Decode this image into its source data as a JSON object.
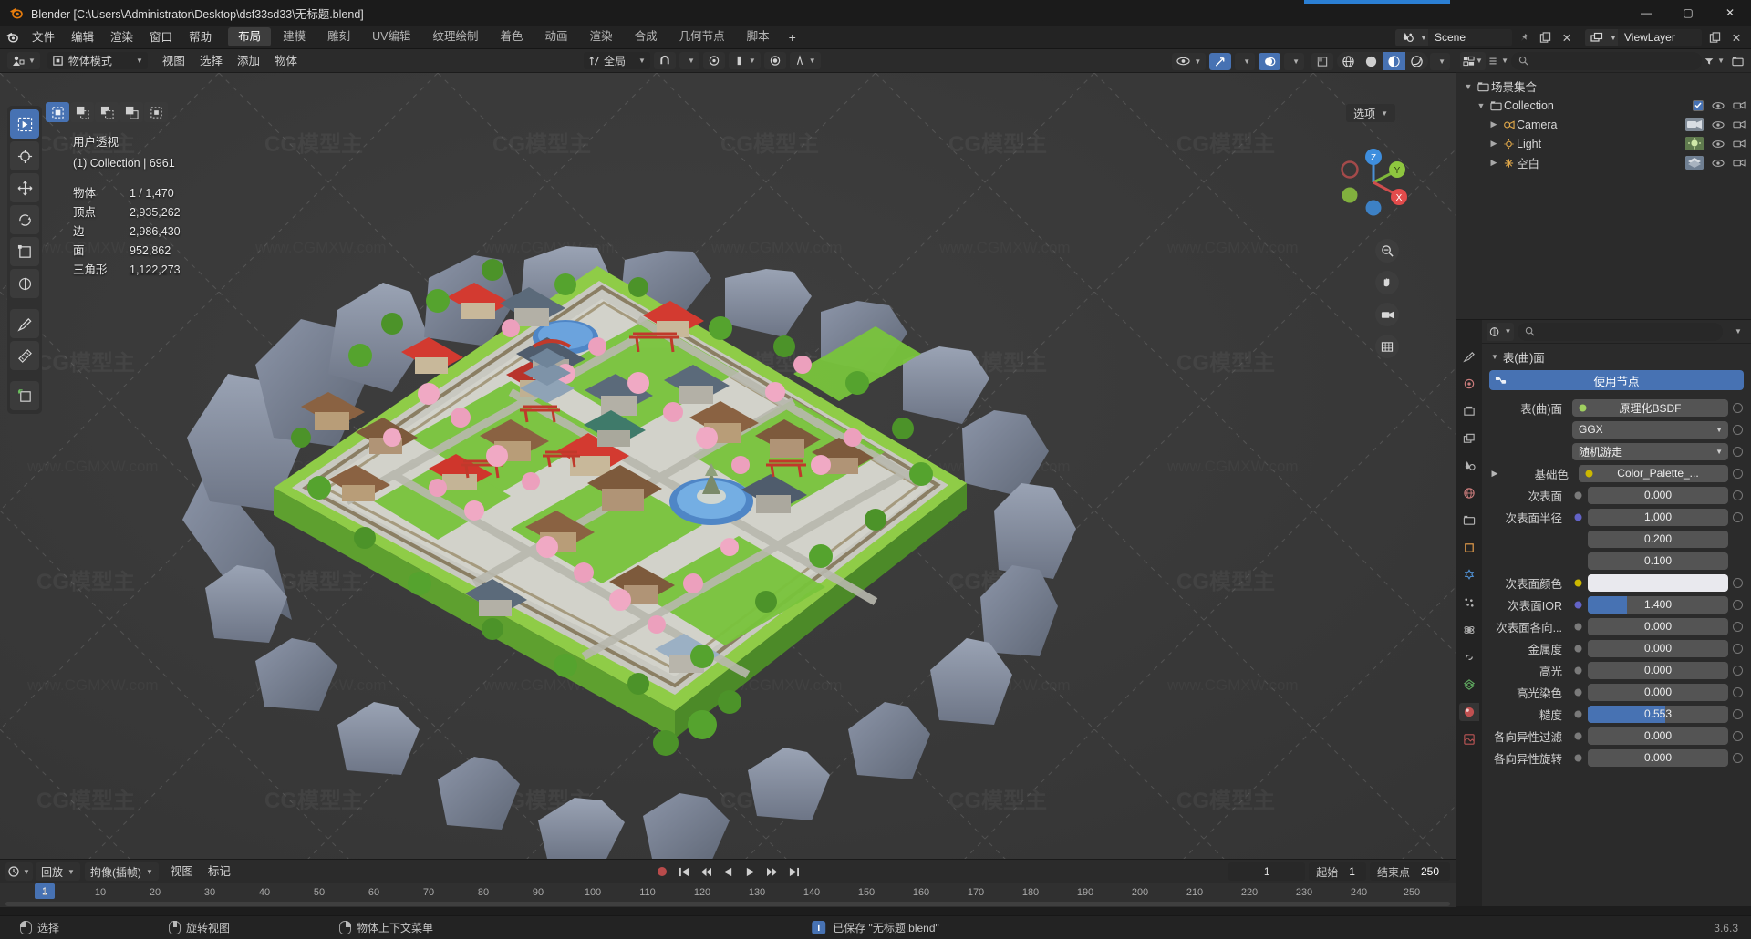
{
  "window": {
    "title": "Blender [C:\\Users\\Administrator\\Desktop\\dsf33sd33\\无标题.blend]",
    "minimize": "—",
    "maximize": "▢",
    "close": "✕"
  },
  "topbar": {
    "menus": [
      "文件",
      "编辑",
      "渲染",
      "窗口",
      "帮助"
    ],
    "workspaces": [
      "布局",
      "建模",
      "雕刻",
      "UV编辑",
      "纹理绘制",
      "着色",
      "动画",
      "渲染",
      "合成",
      "几何节点",
      "脚本"
    ],
    "active_workspace": "布局",
    "add_workspace": "+",
    "scene_name": "Scene",
    "view_layer_name": "ViewLayer"
  },
  "viewport": {
    "mode": "物体模式",
    "menus": [
      "视图",
      "选择",
      "添加",
      "物体"
    ],
    "transform_orientation": "全局",
    "options_label": "选项",
    "stats": {
      "view_name": "用户透视",
      "collection_line": "(1) Collection | 6961",
      "rows": [
        {
          "label": "物体",
          "value": "1 / 1,470"
        },
        {
          "label": "顶点",
          "value": "2,935,262"
        },
        {
          "label": "边",
          "value": "2,986,430"
        },
        {
          "label": "面",
          "value": "952,862"
        },
        {
          "label": "三角形",
          "value": "1,122,273"
        }
      ]
    },
    "gizmo_axes": [
      "X",
      "Y",
      "Z"
    ]
  },
  "outliner": {
    "filter_placeholder": "",
    "rows": [
      {
        "name": "场景集合",
        "icon": "collection-icon",
        "indent": 0,
        "expanded": true,
        "checkbox": false,
        "eye": false,
        "camera": false,
        "thumb": false
      },
      {
        "name": "Collection",
        "icon": "collection-icon",
        "indent": 1,
        "expanded": true,
        "checkbox": true,
        "eye": true,
        "camera": true,
        "thumb": false
      },
      {
        "name": "Camera",
        "icon": "camera-icon",
        "indent": 2,
        "expanded": false,
        "checkbox": false,
        "eye": true,
        "camera": true,
        "thumb": true
      },
      {
        "name": "Light",
        "icon": "light-icon",
        "indent": 2,
        "expanded": false,
        "checkbox": false,
        "eye": true,
        "camera": true,
        "thumb": true
      },
      {
        "name": "空白",
        "icon": "empty-icon",
        "indent": 2,
        "expanded": false,
        "checkbox": false,
        "eye": true,
        "camera": true,
        "thumb": true
      }
    ]
  },
  "properties": {
    "search_placeholder": "",
    "panel_title": "表(曲)面",
    "use_nodes_label": "使用节点",
    "rows": [
      {
        "label": "表(曲)面",
        "type": "select",
        "value": "原理化BSDF",
        "socket": "#a0d060"
      },
      {
        "label": "",
        "type": "select-indent",
        "value": "GGX"
      },
      {
        "label": "",
        "type": "select-indent",
        "value": "随机游走"
      },
      {
        "label": "基础色",
        "type": "link",
        "value": "Color_Palette_...",
        "socket": "#ccb800",
        "expandable": true
      },
      {
        "label": "次表面",
        "type": "value",
        "value": "0.000"
      },
      {
        "label": "次表面半径",
        "type": "value",
        "value": "1.000",
        "socket": "#6363c7"
      },
      {
        "label": "",
        "type": "value-indent",
        "value": "0.200"
      },
      {
        "label": "",
        "type": "value-indent",
        "value": "0.100"
      },
      {
        "label": "次表面颜色",
        "type": "color",
        "value": "",
        "socket": "#ccb800",
        "swatch": "#e9e9ee"
      },
      {
        "label": "次表面IOR",
        "type": "value-fill",
        "value": "1.400",
        "fill_pct": 28,
        "socket": "#6363c7"
      },
      {
        "label": "次表面各向...",
        "type": "value",
        "value": "0.000"
      },
      {
        "label": "金属度",
        "type": "value",
        "value": "0.000"
      },
      {
        "label": "高光",
        "type": "value",
        "value": "0.000"
      },
      {
        "label": "高光染色",
        "type": "value",
        "value": "0.000"
      },
      {
        "label": "糙度",
        "type": "value-fill",
        "value": "0.553",
        "fill_pct": 55,
        "highlight": true
      },
      {
        "label": "各向异性过滤",
        "type": "value",
        "value": "0.000"
      },
      {
        "label": "各向异性旋转",
        "type": "value",
        "value": "0.000"
      }
    ]
  },
  "timeline": {
    "editor_menus": [
      "回放",
      "拘像(插帧)",
      "视图",
      "标记"
    ],
    "playback_label": "回放",
    "keying_label": "拘像(插帧)",
    "view_label": "视图",
    "marker_label": "标记",
    "current_frame": "1",
    "start_label": "起始",
    "start_value": "1",
    "end_label": "结束点",
    "end_value": "250",
    "ticks": [
      "1",
      "10",
      "20",
      "30",
      "40",
      "50",
      "60",
      "70",
      "80",
      "90",
      "100",
      "110",
      "120",
      "130",
      "140",
      "150",
      "160",
      "170",
      "180",
      "190",
      "200",
      "210",
      "220",
      "230",
      "240",
      "250"
    ],
    "playhead": "1"
  },
  "statusbar": {
    "select_label": "选择",
    "rotate_label": "旋转视图",
    "context_menu_label": "物体上下文菜单",
    "message": "已保存 \"无标题.blend\"",
    "version": "3.6.3"
  },
  "colors": {
    "accent": "#4772b3",
    "header_bg": "#2b2b2b",
    "viewport_bg": "#393939",
    "field_bg": "#545454"
  },
  "watermarks": {
    "logo_text": "CG模型主",
    "url_text": "www.CGMXW.com"
  }
}
